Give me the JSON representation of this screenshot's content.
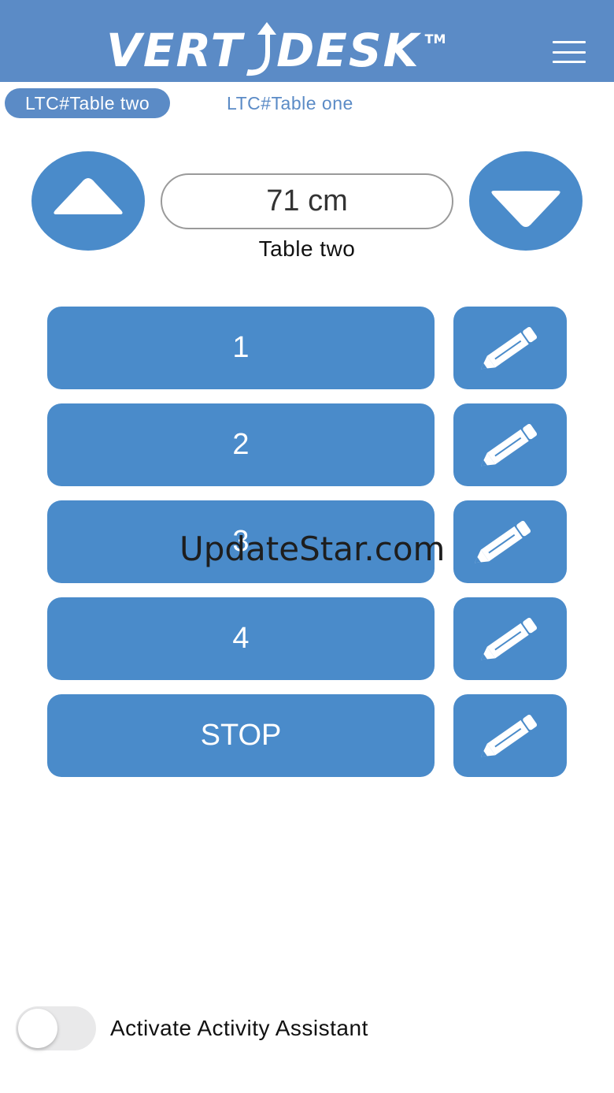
{
  "header": {
    "logo_left": "VERT",
    "logo_right": "DESK",
    "logo_tm": "TM"
  },
  "tabs": [
    {
      "label": "LTC#Table two",
      "active": true
    },
    {
      "label": "LTC#Table one",
      "active": false
    }
  ],
  "controls": {
    "height_value": "71 cm",
    "table_name": "Table two"
  },
  "presets": [
    {
      "label": "1"
    },
    {
      "label": "2"
    },
    {
      "label": "3"
    },
    {
      "label": "4"
    },
    {
      "label": "STOP"
    }
  ],
  "watermark": "UpdateStar.com",
  "toggle": {
    "label": "Activate Activity Assistant",
    "on": false
  },
  "colors": {
    "header_bg": "#5b8bc6",
    "button_bg": "#4a8bca",
    "text_dark": "#111111"
  },
  "icons": [
    "hamburger-menu-icon",
    "arrow-up-icon",
    "arrow-down-icon",
    "pencil-icon"
  ]
}
